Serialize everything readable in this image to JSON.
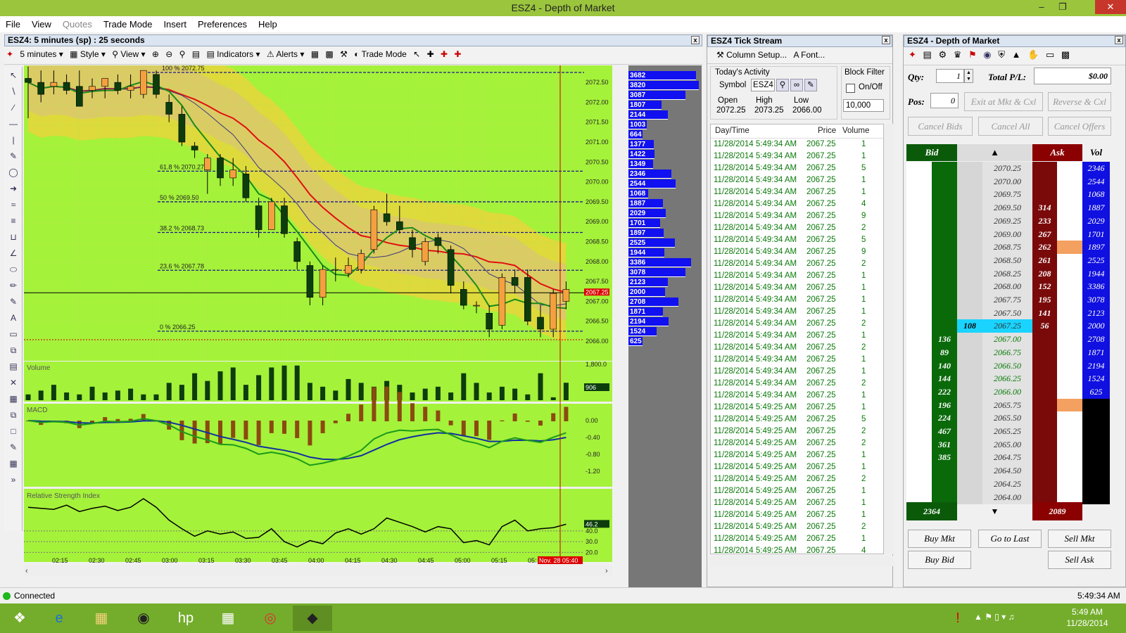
{
  "window": {
    "title": "ESZ4 - Depth of Market"
  },
  "menu": [
    "File",
    "View",
    "Quotes",
    "Trade Mode",
    "Insert",
    "Preferences",
    "Help"
  ],
  "chart": {
    "panel_title": "ESZ4: 5 minutes (sp) : 25 seconds",
    "toolbar": {
      "interval": "5 minutes",
      "style": "Style",
      "view": "View",
      "indicators": "Indicators",
      "alerts": "Alerts",
      "trade_mode": "Trade Mode"
    },
    "fib": [
      "100 % 2072.75",
      "61.8 % 2070.27",
      "50 % 2069.50",
      "38.2 % 2068.73",
      "23.6 % 2067.78",
      "0 % 2066.25"
    ],
    "price_ticks": [
      "2072.50",
      "2072.00",
      "2071.50",
      "2071.00",
      "2070.50",
      "2070.00",
      "2069.50",
      "2069.00",
      "2068.50",
      "2068.00",
      "2067.50",
      "2067.00",
      "2066.50",
      "2066.00"
    ],
    "last_price_label": "2067.25",
    "volume_label": "Volume",
    "volume_ticks": [
      "1,800.0"
    ],
    "volume_last": "906",
    "macd_label": "MACD",
    "macd_ticks": [
      "0.00",
      "-0.40",
      "-0.80",
      "-1.20"
    ],
    "rsi_label": "Relative Strength Index",
    "rsi_ticks": [
      "40.0",
      "30.0",
      "20.0"
    ],
    "rsi_last": "46.2",
    "time_ticks": [
      "02:15",
      "02:30",
      "02:45",
      "03:00",
      "03:15",
      "03:30",
      "03:45",
      "04:00",
      "04:15",
      "04:30",
      "04:45",
      "05:00",
      "05:15",
      "05:"
    ],
    "cursor_time": "Nov. 28 05:40",
    "dom_volumes": [
      "3682",
      "3820",
      "3087",
      "1807",
      "2144",
      "1003",
      "664",
      "1377",
      "1422",
      "1349",
      "2346",
      "2544",
      "1068",
      "1887",
      "2029",
      "1701",
      "1897",
      "2525",
      "1944",
      "3386",
      "3078",
      "2123",
      "2000",
      "2708",
      "1871",
      "2194",
      "1524",
      "625"
    ]
  },
  "chart_data": {
    "type": "line",
    "title": "ESZ4: 5 minutes (sp) : 25 seconds",
    "candles": [
      {
        "o": 2072.6,
        "h": 2072.9,
        "l": 2071.6,
        "c": 2072.5
      },
      {
        "o": 2072.5,
        "h": 2072.8,
        "l": 2072.0,
        "c": 2072.2
      },
      {
        "o": 2072.4,
        "h": 2072.8,
        "l": 2072.2,
        "c": 2072.5
      },
      {
        "o": 2072.5,
        "h": 2072.7,
        "l": 2072.2,
        "c": 2072.3
      },
      {
        "o": 2072.4,
        "h": 2072.8,
        "l": 2071.9,
        "c": 2071.9
      },
      {
        "o": 2072.3,
        "h": 2072.6,
        "l": 2072.1,
        "c": 2072.4
      },
      {
        "o": 2072.4,
        "h": 2072.6,
        "l": 2072.1,
        "c": 2072.6
      },
      {
        "o": 2072.5,
        "h": 2072.7,
        "l": 2072.2,
        "c": 2072.3
      },
      {
        "o": 2072.3,
        "h": 2072.7,
        "l": 2072.1,
        "c": 2072.4
      },
      {
        "o": 2072.2,
        "h": 2072.8,
        "l": 2072.1,
        "c": 2072.8
      },
      {
        "o": 2072.7,
        "h": 2072.8,
        "l": 2072.1,
        "c": 2072.2
      },
      {
        "o": 2072.0,
        "h": 2072.2,
        "l": 2071.5,
        "c": 2071.7
      },
      {
        "o": 2071.7,
        "h": 2071.9,
        "l": 2070.9,
        "c": 2071.0
      },
      {
        "o": 2070.9,
        "h": 2071.0,
        "l": 2070.6,
        "c": 2070.8
      },
      {
        "o": 2070.3,
        "h": 2070.7,
        "l": 2069.7,
        "c": 2070.6
      },
      {
        "o": 2070.6,
        "h": 2070.7,
        "l": 2069.9,
        "c": 2070.1
      },
      {
        "o": 2070.1,
        "h": 2070.6,
        "l": 2069.9,
        "c": 2070.3
      },
      {
        "o": 2070.2,
        "h": 2070.4,
        "l": 2069.5,
        "c": 2069.6
      },
      {
        "o": 2069.4,
        "h": 2069.6,
        "l": 2068.6,
        "c": 2068.8
      },
      {
        "o": 2068.8,
        "h": 2069.6,
        "l": 2068.8,
        "c": 2069.5
      },
      {
        "o": 2069.4,
        "h": 2069.6,
        "l": 2068.6,
        "c": 2068.7
      },
      {
        "o": 2068.5,
        "h": 2068.6,
        "l": 2067.8,
        "c": 2068.0
      },
      {
        "o": 2067.9,
        "h": 2068.0,
        "l": 2066.9,
        "c": 2067.1
      },
      {
        "o": 2067.1,
        "h": 2067.9,
        "l": 2066.9,
        "c": 2067.8
      },
      {
        "o": 2067.8,
        "h": 2068.1,
        "l": 2067.5,
        "c": 2067.8
      },
      {
        "o": 2067.7,
        "h": 2068.1,
        "l": 2067.6,
        "c": 2067.9
      },
      {
        "o": 2067.8,
        "h": 2068.3,
        "l": 2067.7,
        "c": 2068.2
      },
      {
        "o": 2068.3,
        "h": 2069.4,
        "l": 2068.2,
        "c": 2069.3
      },
      {
        "o": 2069.2,
        "h": 2069.7,
        "l": 2068.9,
        "c": 2069.0
      },
      {
        "o": 2069.0,
        "h": 2069.4,
        "l": 2068.7,
        "c": 2068.8
      },
      {
        "o": 2068.6,
        "h": 2068.8,
        "l": 2068.1,
        "c": 2068.3
      },
      {
        "o": 2068.0,
        "h": 2068.6,
        "l": 2067.9,
        "c": 2068.5
      },
      {
        "o": 2068.6,
        "h": 2068.7,
        "l": 2068.2,
        "c": 2068.4
      },
      {
        "o": 2068.3,
        "h": 2068.4,
        "l": 2067.2,
        "c": 2067.4
      },
      {
        "o": 2067.3,
        "h": 2067.5,
        "l": 2066.8,
        "c": 2066.9
      },
      {
        "o": 2066.9,
        "h": 2067.0,
        "l": 2066.7,
        "c": 2066.9
      },
      {
        "o": 2066.7,
        "h": 2066.9,
        "l": 2066.1,
        "c": 2066.3
      },
      {
        "o": 2066.4,
        "h": 2067.7,
        "l": 2066.3,
        "c": 2067.6
      },
      {
        "o": 2067.6,
        "h": 2067.8,
        "l": 2067.2,
        "c": 2067.4
      },
      {
        "o": 2067.6,
        "h": 2067.8,
        "l": 2066.4,
        "c": 2066.5
      },
      {
        "o": 2066.6,
        "h": 2066.9,
        "l": 2066.1,
        "c": 2066.3
      },
      {
        "o": 2066.3,
        "h": 2067.3,
        "l": 2066.1,
        "c": 2067.2
      },
      {
        "o": 2067.0,
        "h": 2067.5,
        "l": 2066.8,
        "c": 2067.3
      }
    ],
    "volume": [
      300,
      500,
      800,
      400,
      300,
      700,
      400,
      500,
      600,
      300,
      300,
      900,
      800,
      1400,
      1000,
      1500,
      1700,
      800,
      1300,
      1700,
      1800,
      1800,
      900,
      700,
      500,
      1100,
      900,
      700,
      1000,
      800,
      400,
      600,
      700,
      400,
      1400,
      900,
      400,
      700,
      600,
      300,
      1400,
      150,
      906
    ],
    "rsi": [
      62,
      61,
      60,
      64,
      58,
      61,
      63,
      59,
      62,
      70,
      62,
      50,
      42,
      35,
      40,
      37,
      39,
      33,
      34,
      42,
      30,
      25,
      31,
      28,
      38,
      42,
      37,
      42,
      52,
      48,
      44,
      39,
      44,
      42,
      29,
      31,
      27,
      44,
      50,
      40,
      42,
      43,
      46.2
    ],
    "ylim": [
      2066.0,
      2073.0
    ]
  },
  "tick": {
    "panel_title": "ESZ4 Tick Stream",
    "column_setup": "Column Setup...",
    "font": "Font...",
    "todays_activity": "Today's Activity",
    "symbol_label": "Symbol",
    "symbol": "ESZ4",
    "open_label": "Open",
    "open": "2072.25",
    "high_label": "High",
    "high": "2073.25",
    "low_label": "Low",
    "low": "2066.00",
    "block_filter": "Block Filter",
    "onoff": "On/Off",
    "filter_value": "10,000",
    "col_time": "Day/Time",
    "col_price": "Price",
    "col_volume": "Volume",
    "rows": [
      [
        "11/28/2014 5:49:34 AM",
        "2067.25",
        "1"
      ],
      [
        "11/28/2014 5:49:34 AM",
        "2067.25",
        "1"
      ],
      [
        "11/28/2014 5:49:34 AM",
        "2067.25",
        "5"
      ],
      [
        "11/28/2014 5:49:34 AM",
        "2067.25",
        "1"
      ],
      [
        "11/28/2014 5:49:34 AM",
        "2067.25",
        "1"
      ],
      [
        "11/28/2014 5:49:34 AM",
        "2067.25",
        "4"
      ],
      [
        "11/28/2014 5:49:34 AM",
        "2067.25",
        "9"
      ],
      [
        "11/28/2014 5:49:34 AM",
        "2067.25",
        "2"
      ],
      [
        "11/28/2014 5:49:34 AM",
        "2067.25",
        "5"
      ],
      [
        "11/28/2014 5:49:34 AM",
        "2067.25",
        "9"
      ],
      [
        "11/28/2014 5:49:34 AM",
        "2067.25",
        "2"
      ],
      [
        "11/28/2014 5:49:34 AM",
        "2067.25",
        "1"
      ],
      [
        "11/28/2014 5:49:34 AM",
        "2067.25",
        "1"
      ],
      [
        "11/28/2014 5:49:34 AM",
        "2067.25",
        "1"
      ],
      [
        "11/28/2014 5:49:34 AM",
        "2067.25",
        "1"
      ],
      [
        "11/28/2014 5:49:34 AM",
        "2067.25",
        "2"
      ],
      [
        "11/28/2014 5:49:34 AM",
        "2067.25",
        "1"
      ],
      [
        "11/28/2014 5:49:34 AM",
        "2067.25",
        "2"
      ],
      [
        "11/28/2014 5:49:34 AM",
        "2067.25",
        "1"
      ],
      [
        "11/28/2014 5:49:34 AM",
        "2067.25",
        "1"
      ],
      [
        "11/28/2014 5:49:34 AM",
        "2067.25",
        "2"
      ],
      [
        "11/28/2014 5:49:34 AM",
        "2067.25",
        "1"
      ],
      [
        "11/28/2014 5:49:25 AM",
        "2067.25",
        "1"
      ],
      [
        "11/28/2014 5:49:25 AM",
        "2067.25",
        "5"
      ],
      [
        "11/28/2014 5:49:25 AM",
        "2067.25",
        "2"
      ],
      [
        "11/28/2014 5:49:25 AM",
        "2067.25",
        "2"
      ],
      [
        "11/28/2014 5:49:25 AM",
        "2067.25",
        "1"
      ],
      [
        "11/28/2014 5:49:25 AM",
        "2067.25",
        "1"
      ],
      [
        "11/28/2014 5:49:25 AM",
        "2067.25",
        "2"
      ],
      [
        "11/28/2014 5:49:25 AM",
        "2067.25",
        "1"
      ],
      [
        "11/28/2014 5:49:25 AM",
        "2067.25",
        "1"
      ],
      [
        "11/28/2014 5:49:25 AM",
        "2067.25",
        "1"
      ],
      [
        "11/28/2014 5:49:25 AM",
        "2067.25",
        "2"
      ],
      [
        "11/28/2014 5:49:25 AM",
        "2067.25",
        "1"
      ],
      [
        "11/28/2014 5:49:25 AM",
        "2067.25",
        "4"
      ]
    ]
  },
  "dom": {
    "panel_title": "ESZ4 - Depth of Market",
    "qty_label": "Qty:",
    "qty": "1",
    "total_pl_label": "Total P/L:",
    "total_pl": "$0.00",
    "pos_label": "Pos:",
    "pos": "0",
    "exit_btn": "Exit at Mkt & Cxl",
    "reverse_btn": "Reverse & Cxl",
    "cancel_bids": "Cancel Bids",
    "cancel_all": "Cancel All",
    "cancel_offers": "Cancel Offers",
    "hdr_bid": "Bid",
    "hdr_ask": "Ask",
    "hdr_vol": "Vol",
    "rows": [
      {
        "price": "2070.25",
        "bid": "",
        "ask": "",
        "vol": "2346"
      },
      {
        "price": "2070.00",
        "bid": "",
        "ask": "",
        "vol": "2544"
      },
      {
        "price": "2069.75",
        "bid": "",
        "ask": "",
        "vol": "1068"
      },
      {
        "price": "2069.50",
        "bid": "",
        "ask": "314",
        "vol": "1887"
      },
      {
        "price": "2069.25",
        "bid": "",
        "ask": "233",
        "vol": "2029"
      },
      {
        "price": "2069.00",
        "bid": "",
        "ask": "267",
        "vol": "1701"
      },
      {
        "price": "2068.75",
        "bid": "",
        "ask": "262",
        "vol": "1897"
      },
      {
        "price": "2068.50",
        "bid": "",
        "ask": "261",
        "vol": "2525"
      },
      {
        "price": "2068.25",
        "bid": "",
        "ask": "208",
        "vol": "1944"
      },
      {
        "price": "2068.00",
        "bid": "",
        "ask": "152",
        "vol": "3386"
      },
      {
        "price": "2067.75",
        "bid": "",
        "ask": "195",
        "vol": "3078"
      },
      {
        "price": "2067.50",
        "bid": "",
        "ask": "141",
        "vol": "2123"
      },
      {
        "price": "2067.25",
        "bid": "",
        "ask": "56",
        "vol": "2000",
        "last": "108"
      },
      {
        "price": "2067.00",
        "bid": "136",
        "ask": "",
        "vol": "2708"
      },
      {
        "price": "2066.75",
        "bid": "89",
        "ask": "",
        "vol": "1871"
      },
      {
        "price": "2066.50",
        "bid": "140",
        "ask": "",
        "vol": "2194"
      },
      {
        "price": "2066.25",
        "bid": "144",
        "ask": "",
        "vol": "1524"
      },
      {
        "price": "2066.00",
        "bid": "222",
        "ask": "",
        "vol": "625"
      },
      {
        "price": "2065.75",
        "bid": "196",
        "ask": "",
        "vol": ""
      },
      {
        "price": "2065.50",
        "bid": "224",
        "ask": "",
        "vol": ""
      },
      {
        "price": "2065.25",
        "bid": "467",
        "ask": "",
        "vol": ""
      },
      {
        "price": "2065.00",
        "bid": "361",
        "ask": "",
        "vol": ""
      },
      {
        "price": "2064.75",
        "bid": "385",
        "ask": "",
        "vol": ""
      },
      {
        "price": "2064.50",
        "bid": "",
        "ask": "",
        "vol": ""
      },
      {
        "price": "2064.25",
        "bid": "",
        "ask": "",
        "vol": ""
      },
      {
        "price": "2064.00",
        "bid": "",
        "ask": "",
        "vol": ""
      }
    ],
    "total_bid": "2364",
    "total_ask": "2089",
    "buy_mkt": "Buy Mkt",
    "go_to_last": "Go to Last",
    "sell_mkt": "Sell Mkt",
    "buy_bid": "Buy Bid",
    "sell_ask": "Sell Ask"
  },
  "status": {
    "connected": "Connected",
    "time": "5:49:34 AM"
  },
  "taskbar": {
    "clock_time": "5:49 AM",
    "clock_date": "11/28/2014"
  }
}
